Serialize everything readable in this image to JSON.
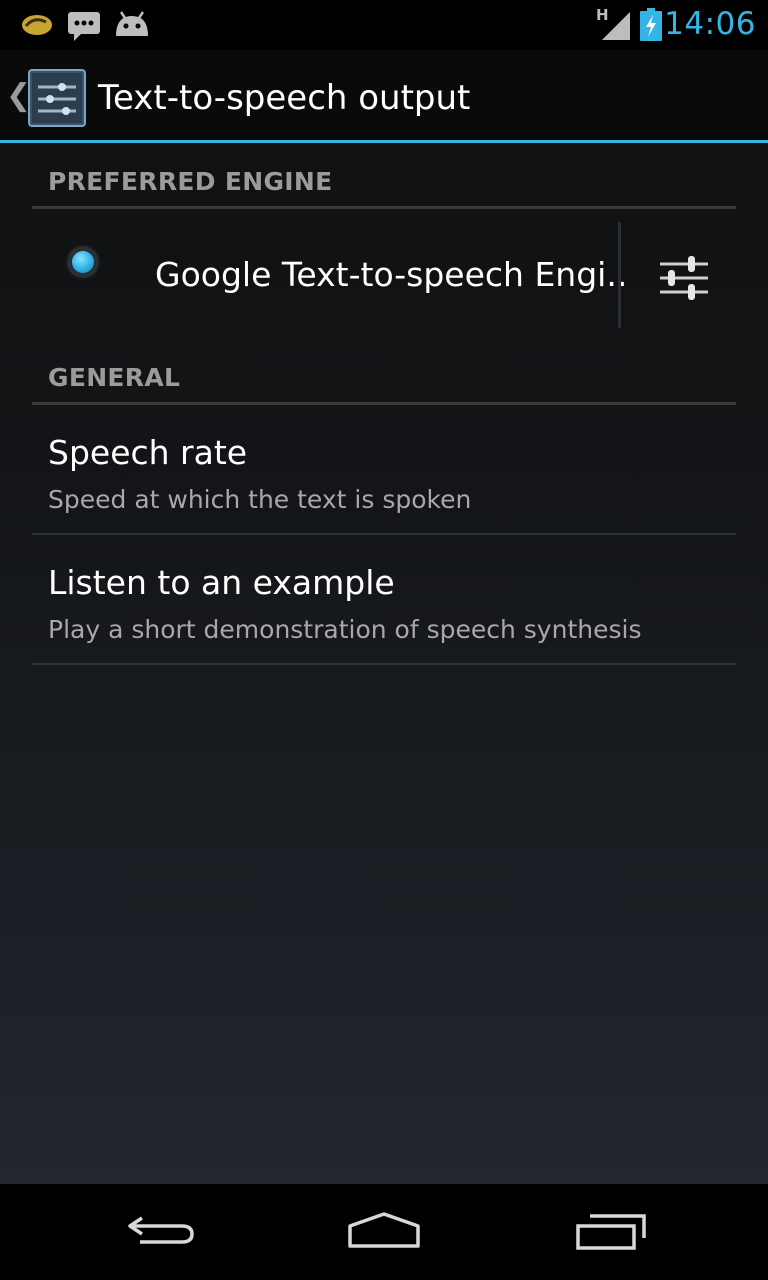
{
  "status_bar": {
    "time": "14:06",
    "network_type": "H",
    "icons": [
      "notification-bean-icon",
      "sms-icon",
      "android-icon",
      "signal-icon",
      "battery-charging-icon"
    ]
  },
  "action_bar": {
    "title": "Text-to-speech output",
    "app_icon": "settings-sliders-icon"
  },
  "sections": {
    "preferred_engine": {
      "header": "PREFERRED ENGINE",
      "engine_label": "Google Text-to-speech Engi..",
      "selected": true
    },
    "general": {
      "header": "GENERAL",
      "items": [
        {
          "title": "Speech rate",
          "summary": "Speed at which the text is spoken"
        },
        {
          "title": "Listen to an example",
          "summary": "Play a short demonstration of speech synthesis"
        }
      ]
    }
  },
  "nav_bar": {
    "buttons": [
      "back-icon",
      "home-icon",
      "recent-apps-icon"
    ]
  },
  "colors": {
    "accent": "#33b5e5",
    "section_header": "#9b9b9b",
    "summary_text": "#a8a8a8"
  }
}
